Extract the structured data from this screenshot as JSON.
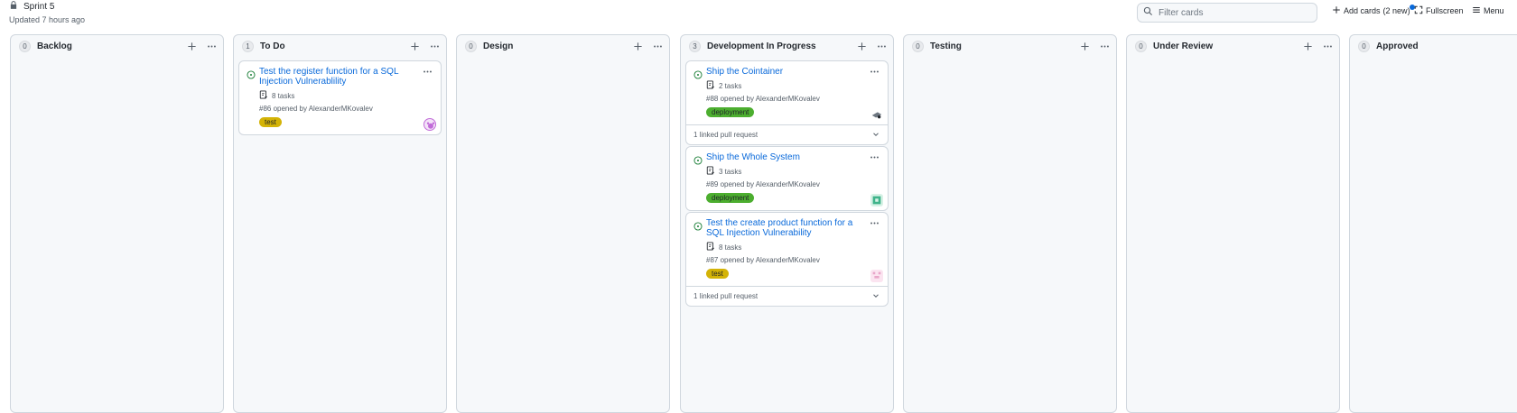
{
  "header": {
    "title": "Sprint 5",
    "updated": "Updated 7 hours ago",
    "filter_placeholder": "Filter cards",
    "add_cards_label": "Add cards",
    "add_cards_badge": "2 new",
    "fullscreen_label": "Fullscreen",
    "menu_label": "Menu",
    "lock_icon": "lock-icon",
    "search_icon": "search-icon"
  },
  "columns": [
    {
      "name": "Backlog",
      "count": "0"
    },
    {
      "name": "To Do",
      "count": "1"
    },
    {
      "name": "Design",
      "count": "0"
    },
    {
      "name": "Development In Progress",
      "count": "3"
    },
    {
      "name": "Testing",
      "count": "0"
    },
    {
      "name": "Under Review",
      "count": "0"
    },
    {
      "name": "Approved",
      "count": "0"
    }
  ],
  "cards": [
    {
      "title": "Test the register function for a SQL Injection Vulnerablility",
      "tasks": "8 tasks",
      "meta": "#86 opened by AlexanderMKovalev",
      "label": "test",
      "label_color": "#d4b306",
      "avatar_color": "#c16bd8"
    },
    {
      "title": "Ship the Cointainer",
      "tasks": "2 tasks",
      "meta": "#88 opened by AlexanderMKovalev",
      "label": "deployment",
      "label_color": "#4cae2f",
      "linked_pr": "1 linked pull request",
      "avatar_color": "#6e7781"
    },
    {
      "title": "Ship the Whole System",
      "tasks": "3 tasks",
      "meta": "#89 opened by AlexanderMKovalev",
      "label": "deployment",
      "label_color": "#4cae2f",
      "avatar_color": "#3fb38a"
    },
    {
      "title": "Test the create product function for a SQL Injection Vulnerability",
      "tasks": "8 tasks",
      "meta": "#87 opened by AlexanderMKovalev",
      "label": "test",
      "label_color": "#d4b306",
      "linked_pr": "1 linked pull request",
      "avatar_color": "#e9a6c9"
    }
  ]
}
